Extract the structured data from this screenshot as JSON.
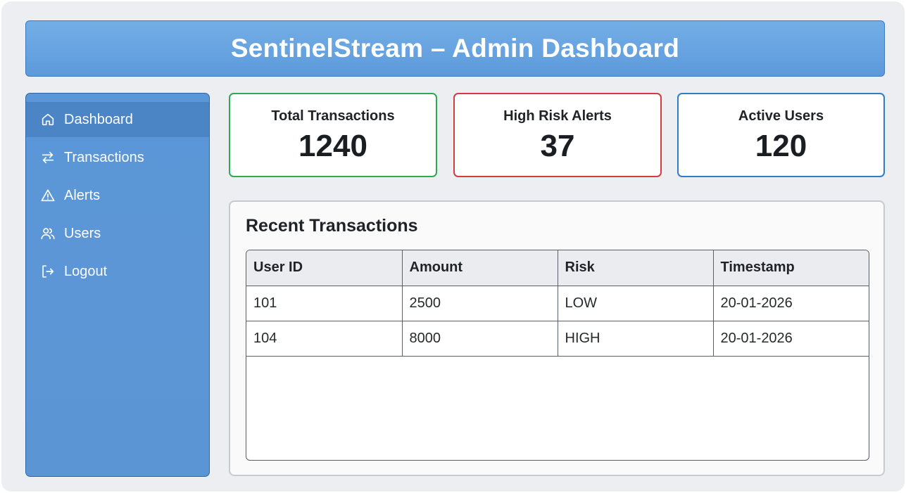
{
  "header": {
    "title": "SentinelStream – Admin Dashboard"
  },
  "sidebar": {
    "items": [
      {
        "label": "Dashboard",
        "icon": "home-icon",
        "active": true
      },
      {
        "label": "Transactions",
        "icon": "transfer-arrows-icon"
      },
      {
        "label": "Alerts",
        "icon": "warning-triangle-icon"
      },
      {
        "label": "Users",
        "icon": "users-icon"
      },
      {
        "label": "Logout",
        "icon": "logout-icon"
      }
    ]
  },
  "stats": [
    {
      "title": "Total Transactions",
      "value": "1240",
      "color": "#2eaa4f"
    },
    {
      "title": "High Risk Alerts",
      "value": "37",
      "color": "#d33a42"
    },
    {
      "title": "Active Users",
      "value": "120",
      "color": "#2f7cc8"
    }
  ],
  "recent": {
    "title": "Recent Transactions",
    "columns": [
      "User ID",
      "Amount",
      "Risk",
      "Timestamp"
    ],
    "rows": [
      [
        "101",
        "2500",
        "LOW",
        "20-01-2026"
      ],
      [
        "104",
        "8000",
        "HIGH",
        "20-01-2026"
      ]
    ]
  },
  "colors": {
    "header": "#5d9adb",
    "sidebar": "#5b97d8",
    "sidebar_active": "#4b85c6"
  }
}
